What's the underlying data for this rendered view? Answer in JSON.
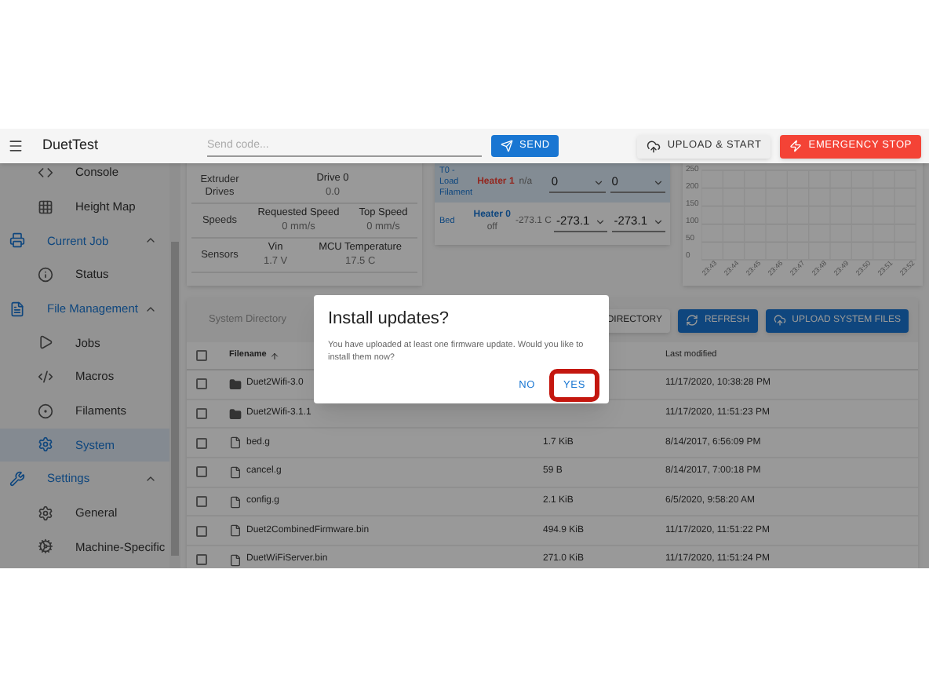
{
  "app_bar": {
    "title": "DuetTest",
    "code_field": {
      "placeholder": "Send code..."
    },
    "send_button": "SEND",
    "upload_button": "UPLOAD & START",
    "emergency_button": "EMERGENCY STOP"
  },
  "sidebar": {
    "items": [
      {
        "kind": "item",
        "label": "Console",
        "selected": false
      },
      {
        "kind": "item",
        "label": "Height Map",
        "selected": false
      },
      {
        "kind": "group",
        "label": "Current Job",
        "expanded": true,
        "children": [
          {
            "kind": "item",
            "label": "Status",
            "selected": false
          }
        ]
      },
      {
        "kind": "group",
        "label": "File Management",
        "expanded": true,
        "children": [
          {
            "kind": "item",
            "label": "Jobs",
            "selected": false
          },
          {
            "kind": "item",
            "label": "Macros",
            "selected": false
          },
          {
            "kind": "item",
            "label": "Filaments",
            "selected": false
          },
          {
            "kind": "item",
            "label": "System",
            "selected": true
          }
        ]
      },
      {
        "kind": "group",
        "label": "Settings",
        "expanded": true,
        "children": [
          {
            "kind": "item",
            "label": "General",
            "selected": false
          },
          {
            "kind": "item",
            "label": "Machine-Specific",
            "selected": false
          }
        ]
      }
    ]
  },
  "machine_status": {
    "rows": [
      {
        "label": "Extruder Drives",
        "cells": [
          {
            "heading": "Drive 0",
            "value": "0.0"
          }
        ]
      },
      {
        "label": "Speeds",
        "cells": [
          {
            "heading": "Requested Speed",
            "value": "0 mm/s"
          },
          {
            "heading": "Top Speed",
            "value": "0 mm/s"
          }
        ]
      },
      {
        "label": "Sensors",
        "cells": [
          {
            "heading": "Vin",
            "value": "1.7 V"
          },
          {
            "heading": "MCU Temperature",
            "value": "17.5 C"
          }
        ]
      }
    ]
  },
  "heaters": {
    "rows": [
      {
        "name": "T0 - Load Filament",
        "selected": true,
        "heater": "Heater 1",
        "alert": true,
        "current": "n/a",
        "active": "0",
        "standby": "0"
      },
      {
        "name": "Bed",
        "selected": false,
        "heater": "Heater 0",
        "alert": false,
        "state": "off",
        "current": "-273.1 C",
        "active": "-273.1",
        "standby": "-273.1"
      }
    ]
  },
  "temperature_chart": {
    "y_labels": [
      "250",
      "200",
      "150",
      "100",
      "50",
      "0"
    ],
    "x_labels": [
      "23:43",
      "23:44",
      "23:45",
      "23:46",
      "23:47",
      "23:48",
      "23:49",
      "23:50",
      "23:51",
      "23:52"
    ]
  },
  "files": {
    "directory_label": "System Directory",
    "buttons": [
      {
        "kind": "plain",
        "label": "DIRECTORY"
      },
      {
        "kind": "primary",
        "label": "REFRESH"
      },
      {
        "kind": "primary",
        "label": "UPLOAD SYSTEM FILES"
      }
    ],
    "all_checked": false,
    "columns": [
      {
        "label": "Filename",
        "sorted": true
      },
      {
        "label": "Last modified",
        "sorted": false
      }
    ],
    "rows": [
      {
        "kind": "folder",
        "name": "Duet2Wifi-3.0",
        "modified": "11/17/2020, 10:38:28 PM",
        "checked": false
      },
      {
        "kind": "folder",
        "name": "Duet2Wifi-3.1.1",
        "modified": "11/17/2020, 11:51:23 PM",
        "checked": false
      },
      {
        "kind": "file",
        "name": "bed.g",
        "size": "1.7 KiB",
        "modified": "8/14/2017, 6:56:09 PM",
        "checked": false
      },
      {
        "kind": "file",
        "name": "cancel.g",
        "size": "59 B",
        "modified": "8/14/2017, 7:00:18 PM",
        "checked": false
      },
      {
        "kind": "file",
        "name": "config.g",
        "size": "2.1 KiB",
        "modified": "6/5/2020, 9:58:20 AM",
        "checked": false
      },
      {
        "kind": "file",
        "name": "Duet2CombinedFirmware.bin",
        "size": "494.9 KiB",
        "modified": "11/17/2020, 11:51:22 PM",
        "checked": false
      },
      {
        "kind": "file",
        "name": "DuetWiFiServer.bin",
        "size": "271.0 KiB",
        "modified": "11/17/2020, 11:51:24 PM",
        "checked": false
      }
    ]
  },
  "dialog": {
    "title": "Install updates?",
    "message": "You have uploaded at least one firmware update. Would you like to install them now?",
    "buttons": [
      {
        "label": "NO",
        "highlighted": false
      },
      {
        "label": "YES",
        "highlighted": true
      }
    ]
  }
}
